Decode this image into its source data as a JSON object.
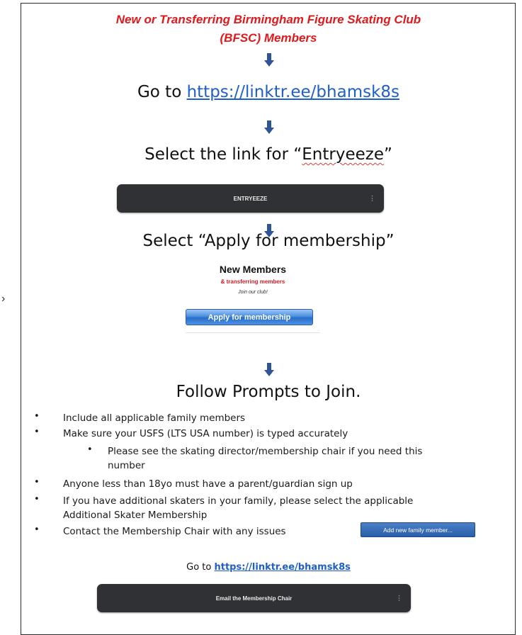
{
  "header": {
    "title_line1": "New or Transferring Birmingham Figure Skating Club",
    "title_line2": "(BFSC) Members"
  },
  "step1": {
    "prefix": "Go to ",
    "link": "https://linktr.ee/bhamsk8s"
  },
  "step2": {
    "prefix": "Select the link for “",
    "keyword": "Entryeeze",
    "suffix": "”",
    "button_label": "ENTRYEEZE",
    "button_menu": "⋮"
  },
  "step3": {
    "heading": "Select “Apply for membership”",
    "card_title": "New Members",
    "card_subtitle": "& transferring members",
    "card_join": "Join our club!",
    "apply_button": "Apply for membership"
  },
  "step4": {
    "heading": "Follow Prompts to Join.",
    "bullet_char": "•",
    "bullets": [
      "Include all applicable family members",
      "Make sure your USFS (LTS USA number) is typed accurately",
      "Please see the skating director/membership chair if you need this",
      "number",
      "Anyone less than 18yo must have a parent/guardian sign up",
      "If you have additional skaters in your family, please select the applicable",
      "Additional Skater Membership",
      "Contact the Membership Chair with any issues"
    ],
    "add_family_button": "Add new family member..."
  },
  "footer": {
    "prefix": "Go to ",
    "link": "https://linktr.ee/bhamsk8s",
    "email_button": "Email the Membership Chair",
    "email_menu": "⋮"
  },
  "side_marker": "›",
  "colors": {
    "title_red": "#e0191d",
    "link_blue": "#1f5fc7",
    "arrow_blue": "#2f5597",
    "dark_button": "#2f3134"
  },
  "icons": [
    "down-arrow-icon",
    "kebab-menu-icon"
  ]
}
